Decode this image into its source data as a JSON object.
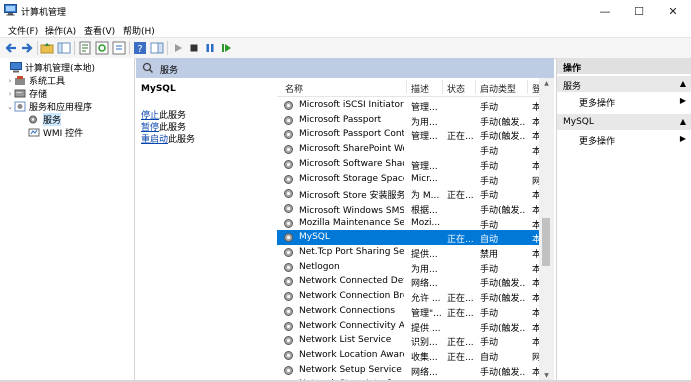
{
  "window": {
    "title": "计算机管理",
    "minimize": "—",
    "maximize": "☐",
    "close": "✕"
  },
  "menu": [
    "文件(F)",
    "操作(A)",
    "查看(V)",
    "帮助(H)"
  ],
  "tree": [
    {
      "label": "计算机管理(本地)",
      "twisty": ""
    },
    {
      "label": "系统工具",
      "twisty": "›"
    },
    {
      "label": "存储",
      "twisty": "›"
    },
    {
      "label": "服务和应用程序",
      "twisty": "⌄"
    },
    {
      "label": "服务",
      "twisty": ""
    },
    {
      "label": "WMI 控件",
      "twisty": ""
    }
  ],
  "services_header": "服务",
  "detail": {
    "name": "MySQL",
    "stop_link": "停止",
    "stop_suffix": "此服务",
    "pause_link": "暂停",
    "pause_suffix": "此服务",
    "restart_link": "重启动",
    "restart_suffix": "此服务"
  },
  "columns": {
    "name": "名称",
    "desc": "描述",
    "status": "状态",
    "startup": "启动类型",
    "logon": "登"
  },
  "rows": [
    {
      "name": "Microsoft iSCSI Initiator Ser...",
      "desc": "管理...",
      "status": "",
      "startup": "手动",
      "logon": "本"
    },
    {
      "name": "Microsoft Passport",
      "desc": "为用...",
      "status": "",
      "startup": "手动(触发...",
      "logon": "本"
    },
    {
      "name": "Microsoft Passport Container",
      "desc": "管理...",
      "status": "正在...",
      "startup": "手动(触发...",
      "logon": "本"
    },
    {
      "name": "Microsoft SharePoint Work...",
      "desc": "",
      "status": "",
      "startup": "手动",
      "logon": "本"
    },
    {
      "name": "Microsoft Software Shado...",
      "desc": "管理...",
      "status": "",
      "startup": "手动",
      "logon": "本"
    },
    {
      "name": "Microsoft Storage Spaces S...",
      "desc": "Micr...",
      "status": "",
      "startup": "手动",
      "logon": "网"
    },
    {
      "name": "Microsoft Store 安装服务",
      "desc": "为 M...",
      "status": "正在...",
      "startup": "手动",
      "logon": "本"
    },
    {
      "name": "Microsoft Windows SMS 路...",
      "desc": "根据...",
      "status": "",
      "startup": "手动(触发...",
      "logon": "本"
    },
    {
      "name": "Mozilla Maintenance Service",
      "desc": "Mozi...",
      "status": "",
      "startup": "手动",
      "logon": "本"
    },
    {
      "name": "MySQL",
      "desc": "",
      "status": "正在...",
      "startup": "自动",
      "logon": "本"
    },
    {
      "name": "Net.Tcp Port Sharing Service",
      "desc": "提供...",
      "status": "",
      "startup": "禁用",
      "logon": "本"
    },
    {
      "name": "Netlogon",
      "desc": "为用...",
      "status": "",
      "startup": "手动",
      "logon": "本"
    },
    {
      "name": "Network Connected Devic...",
      "desc": "网络...",
      "status": "",
      "startup": "手动(触发...",
      "logon": "本"
    },
    {
      "name": "Network Connection Broker",
      "desc": "允许 ...",
      "status": "正在...",
      "startup": "手动(触发...",
      "logon": "本"
    },
    {
      "name": "Network Connections",
      "desc": "管理\"...",
      "status": "正在...",
      "startup": "手动",
      "logon": "本"
    },
    {
      "name": "Network Connectivity Assis...",
      "desc": "提供 ...",
      "status": "",
      "startup": "手动(触发...",
      "logon": "本"
    },
    {
      "name": "Network List Service",
      "desc": "识别...",
      "status": "正在...",
      "startup": "手动",
      "logon": "本"
    },
    {
      "name": "Network Location Awarene...",
      "desc": "收集...",
      "status": "正在...",
      "startup": "自动",
      "logon": "网"
    },
    {
      "name": "Network Setup Service",
      "desc": "网络...",
      "status": "",
      "startup": "手动(触发...",
      "logon": "本"
    },
    {
      "name": "Network Store Interface Se...",
      "desc": "此...",
      "status": "正在...",
      "startup": "自动",
      "logon": "本"
    }
  ],
  "selected_row": 9,
  "actions": {
    "title": "操作",
    "sec1": "服务",
    "sec1_item": "更多操作",
    "sec2": "MySQL",
    "sec2_item": "更多操作",
    "collapse": "▲",
    "more": "▶"
  },
  "colors": {
    "selection": "#0078d7",
    "header_band": "#bfcde4",
    "action_head": "#e8e8e8",
    "link": "#0645ad"
  }
}
